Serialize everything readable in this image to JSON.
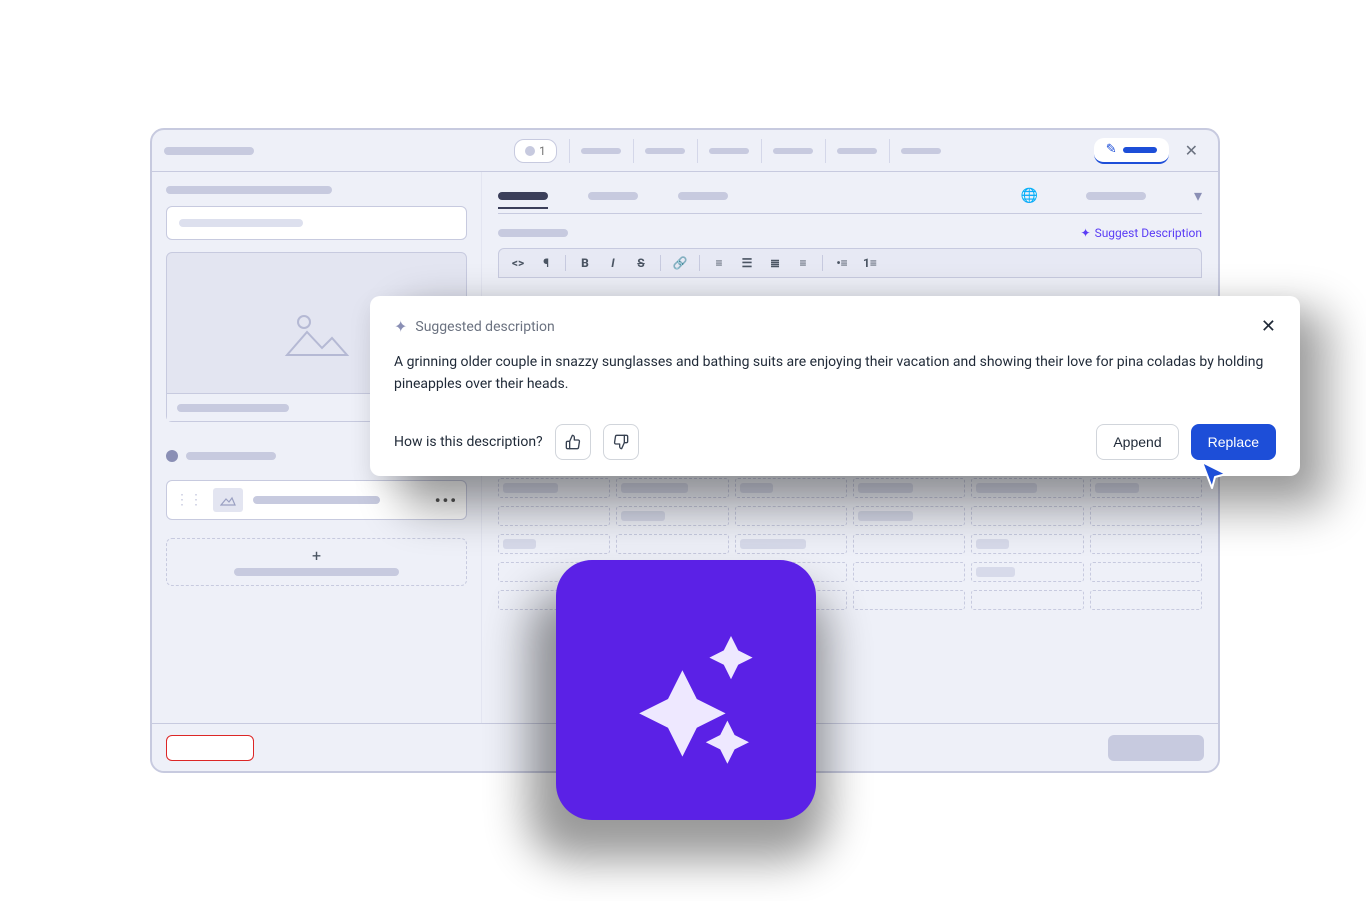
{
  "tabs_count_badge": "1",
  "suggest_description_link": "Suggest Description",
  "modal": {
    "title": "Suggested description",
    "text": "A grinning older couple in snazzy sunglasses and bathing suits are enjoying their vacation and showing their love for pina coladas by holding pineapples over their heads.",
    "feedback_question": "How is this description?",
    "append_label": "Append",
    "replace_label": "Replace"
  }
}
